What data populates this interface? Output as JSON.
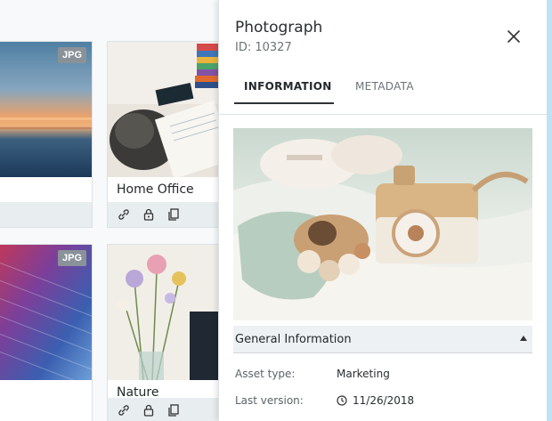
{
  "grid": {
    "cards": [
      {
        "badge": "JPG",
        "title": ""
      },
      {
        "badge": "",
        "title": "Home Office"
      },
      {
        "badge": "JPG",
        "title": ""
      },
      {
        "badge": "",
        "title": "Nature"
      }
    ]
  },
  "panel": {
    "title": "Photograph",
    "id": "ID: 10327",
    "tabs": [
      {
        "label": "INFORMATION",
        "active": true
      },
      {
        "label": "METADATA",
        "active": false
      }
    ],
    "section": {
      "label": "General Information",
      "rows": [
        {
          "key": "Asset type:",
          "value": "Marketing"
        },
        {
          "key": "Last version:",
          "value": "11/26/2018"
        }
      ]
    }
  },
  "icons": {
    "link": "link-icon",
    "lock": "lock-icon",
    "copy": "copy-icon",
    "close": "close-icon",
    "caret": "caret-up-icon",
    "clock": "clock-icon"
  },
  "colors": {
    "page_bg": "#bfe3f2",
    "accent": "#2d3236",
    "badge": "#8a9299"
  }
}
